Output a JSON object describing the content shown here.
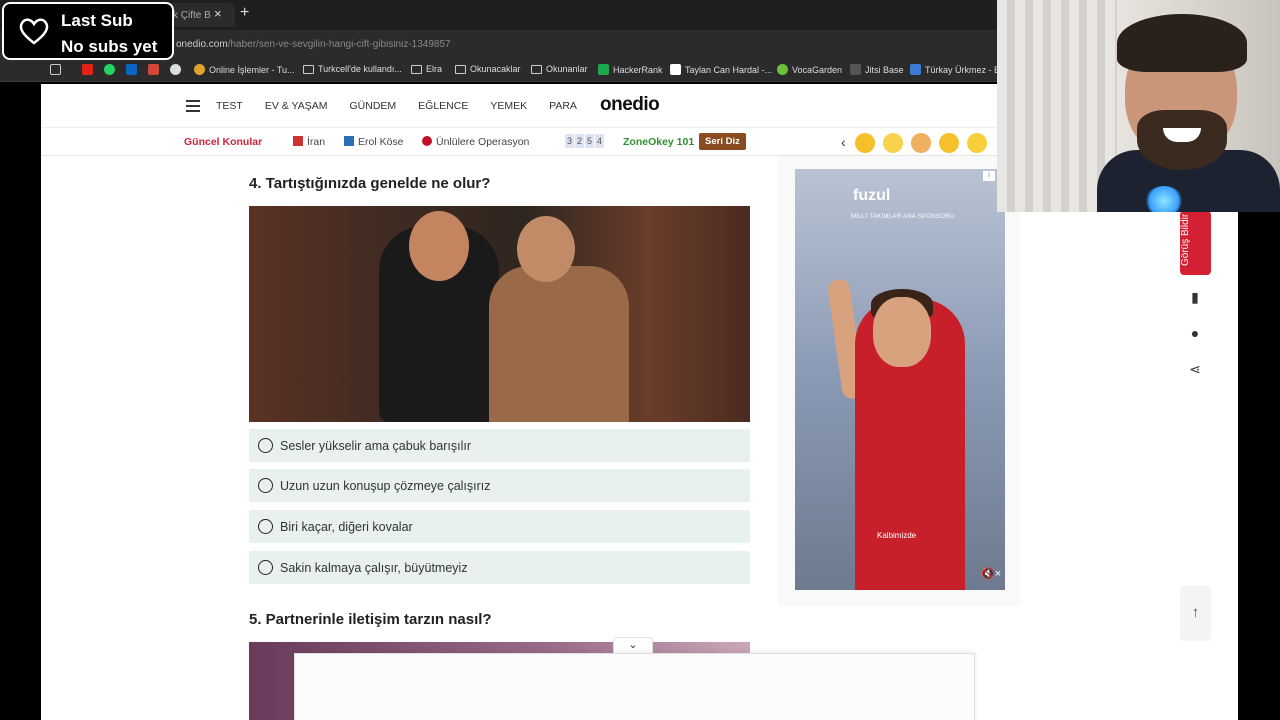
{
  "browser": {
    "tab_title": "k Çifte B",
    "close_glyph": "×",
    "new_tab_glyph": "+",
    "url_domain": "onedio.com",
    "url_path": "/haber/sen-ve-sevgilin-hangi-cift-gibisiniz-1349857",
    "bookmarks": [
      {
        "label": "Online İşlemler - Tu...",
        "icon": "globe-icon",
        "color": "#e1a42b"
      },
      {
        "label": "Turkcell'de kullandı...",
        "icon": "folder-icon",
        "color": "#cccccc"
      },
      {
        "label": "Elra",
        "icon": "folder-icon",
        "color": "#cccccc"
      },
      {
        "label": "Okunacaklar",
        "icon": "folder-icon",
        "color": "#cccccc"
      },
      {
        "label": "Okunanlar",
        "icon": "folder-icon",
        "color": "#cccccc"
      },
      {
        "label": "HackerRank",
        "icon": "hackerrank-icon",
        "color": "#1ba94c"
      },
      {
        "label": "Taylan Can Hardal -...",
        "icon": "medium-icon",
        "color": "#ffffff"
      },
      {
        "label": "VocaGarden",
        "icon": "leaf-icon",
        "color": "#6cbf3a"
      },
      {
        "label": "Jitsi Base",
        "icon": "jitsi-icon",
        "color": "#555555"
      },
      {
        "label": "Türkay Ürkmez - Ev",
        "icon": "blog-icon",
        "color": "#3a7bd5"
      }
    ]
  },
  "overlay": {
    "title": "Last Sub",
    "subtitle": "No subs yet"
  },
  "nav": {
    "links": [
      "TEST",
      "EV & YAŞAM",
      "GÜNDEM",
      "EĞLENCE",
      "YEMEK",
      "PARA"
    ],
    "logo": "onedio"
  },
  "topics": {
    "label": "Güncel Konular",
    "items": [
      "İran",
      "Erol Köse",
      "Ünlülere Operasyon"
    ],
    "zone_digits": [
      "3",
      "2",
      "5",
      "4"
    ],
    "zone_label": "ZoneOkey 101",
    "seri_label": "Seri Diz",
    "prev_glyph": "‹"
  },
  "quiz": {
    "question4": "4. Tartıştığınızda genelde ne olur?",
    "options": [
      "Sesler yükselir ama çabuk barışılır",
      "Uzun uzun konuşup çözmeye çalışırız",
      "Biri kaçar, diğeri kovalar",
      "Sakin kalmaya çalışır, büyütmeyiz"
    ],
    "question5": "5. Partnerinle iletişim tarzın nasıl?"
  },
  "ad": {
    "brand": "fuzul",
    "sub": "MİLLİ TAKIMLAR ANA SPONSORU",
    "caption": "Kalbimizde",
    "mute_glyph": "🔇×",
    "info": "i"
  },
  "side": {
    "feedback_label": "Görüş Bildir",
    "up_glyph": "↑",
    "down_glyph": "⌄"
  }
}
